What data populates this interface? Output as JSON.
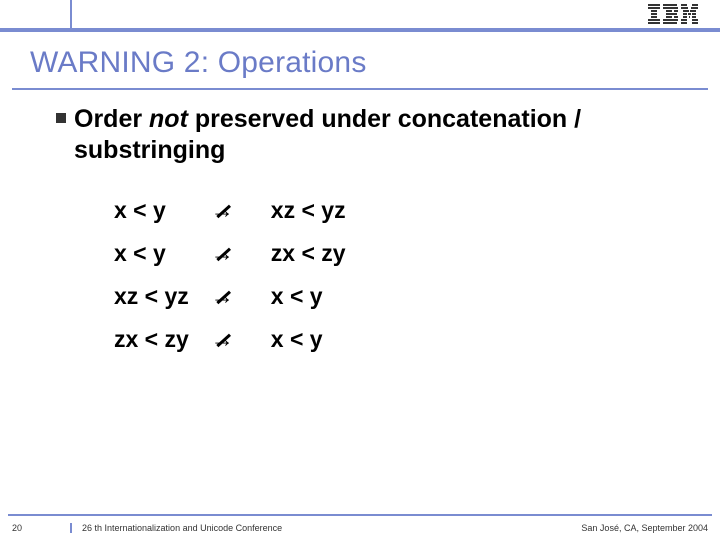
{
  "header": {
    "title": "WARNING 2: Operations",
    "logo_name": "IBM"
  },
  "bullet": {
    "prefix": "Order ",
    "emph": "not",
    "suffix": " preserved under concatenation / substringing"
  },
  "rows": [
    {
      "lhs": "x < y",
      "arrow": "→",
      "rhs": "xz < yz"
    },
    {
      "lhs": "x < y",
      "arrow": "→",
      "rhs": "zx < zy"
    },
    {
      "lhs": "xz < yz",
      "arrow": "→",
      "rhs": "x < y"
    },
    {
      "lhs": "zx < zy",
      "arrow": "→",
      "rhs": "x < y"
    }
  ],
  "footer": {
    "page": "20",
    "left": "26 th Internationalization and Unicode Conference",
    "right": "San José, CA, September 2004"
  }
}
